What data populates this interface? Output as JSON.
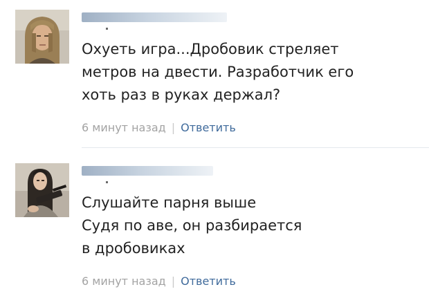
{
  "comments": [
    {
      "avatar": "avatar-man-long-hair",
      "text": "Охуеть игра...Дробовик стреляет\nметров на двести. Разработчик его\nхоть раз в руках держал?",
      "time": "6 минут назад",
      "separator": "|",
      "reply_label": "Ответить"
    },
    {
      "avatar": "avatar-girl-with-shotgun",
      "text": "Слушайте парня выше\nСудя по аве, он разбирается\nв дробовиках",
      "time": "6 минут назад",
      "separator": "|",
      "reply_label": "Ответить"
    }
  ],
  "colors": {
    "text": "#222222",
    "meta": "#a3a3a3",
    "link": "#3f6a9b",
    "divider": "#e4e8ed"
  }
}
